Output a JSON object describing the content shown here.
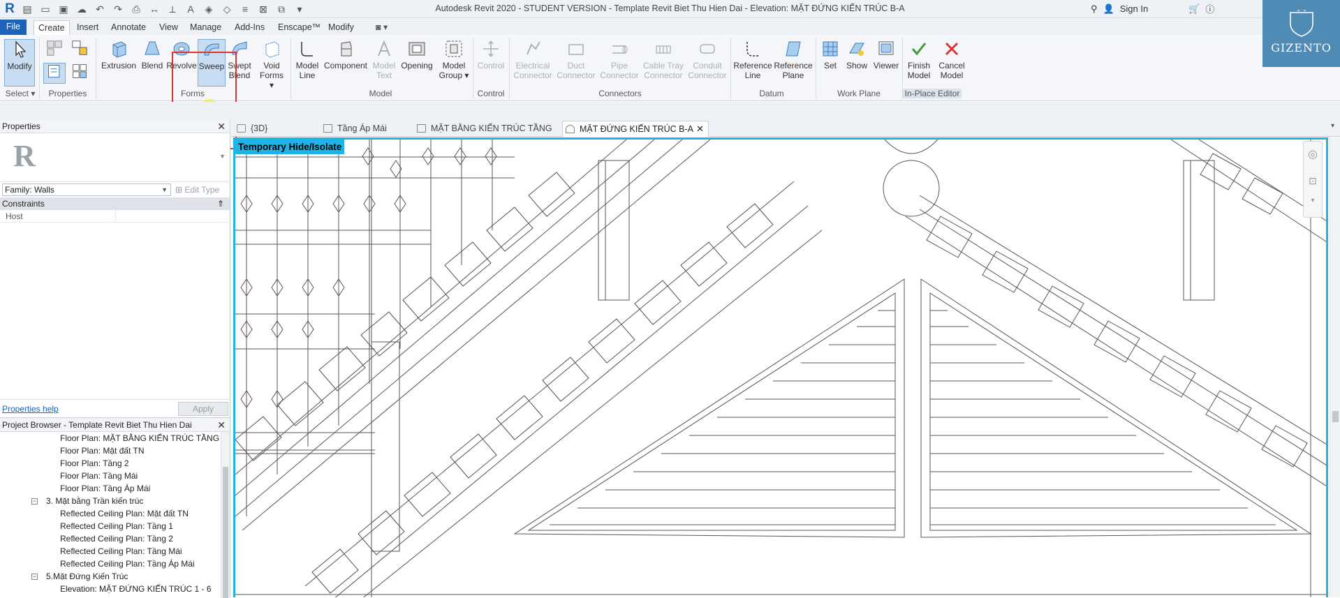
{
  "titlebar": {
    "title": "Autodesk Revit 2020 - STUDENT VERSION - Template Revit Biet Thu Hien Dai - Elevation: MẶT ĐỨNG KIẾN TRÚC B-A",
    "sign_in": "Sign In"
  },
  "menu": [
    "File",
    "Create",
    "Insert",
    "Annotate",
    "View",
    "Manage",
    "Add-Ins",
    "Enscape™",
    "Modify"
  ],
  "ribbon": {
    "select": {
      "modify": "Modify",
      "label": "Select"
    },
    "properties_label": "Properties",
    "forms": {
      "extrusion": "Extrusion",
      "blend": "Blend",
      "revolve": "Revolve",
      "sweep": "Sweep",
      "swept_blend_1": "Swept",
      "swept_blend_2": "Blend",
      "void_1": "Void",
      "void_2": "Forms",
      "label": "Forms"
    },
    "model": {
      "model_line_1": "Model",
      "model_line_2": "Line",
      "component": "Component",
      "model_text_1": "Model",
      "model_text_2": "Text",
      "opening": "Opening",
      "model_group_1": "Model",
      "model_group_2": "Group",
      "label": "Model"
    },
    "control": {
      "control": "Control",
      "label": "Control"
    },
    "connectors": {
      "electrical_1": "Electrical",
      "electrical_2": "Connector",
      "duct_1": "Duct",
      "duct_2": "Connector",
      "pipe_1": "Pipe",
      "pipe_2": "Connector",
      "cable_1": "Cable Tray",
      "cable_2": "Connector",
      "conduit_1": "Conduit",
      "conduit_2": "Connector",
      "label": "Connectors"
    },
    "datum": {
      "ref_line_1": "Reference",
      "ref_line_2": "Line",
      "ref_plane_1": "Reference",
      "ref_plane_2": "Plane",
      "label": "Datum"
    },
    "work_plane": {
      "set": "Set",
      "show": "Show",
      "viewer": "Viewer",
      "label": "Work Plane"
    },
    "inplace": {
      "finish_1": "Finish",
      "finish_2": "Model",
      "cancel_1": "Cancel",
      "cancel_2": "Model",
      "label": "In-Place Editor"
    }
  },
  "brand": {
    "name": "GIZENTO",
    "initial": "G"
  },
  "properties": {
    "title": "Properties",
    "family": "Family: Walls",
    "edit_type": "Edit Type",
    "constraints": "Constraints",
    "host": "Host",
    "help": "Properties help",
    "apply": "Apply"
  },
  "project_browser": {
    "title": "Project Browser - Template Revit Biet Thu Hien Dai",
    "items": [
      {
        "label": "Floor Plan: MẶT BẰNG KIẾN TRÚC TẦNG 1",
        "level": 2
      },
      {
        "label": "Floor Plan: Mặt đất TN",
        "level": 2
      },
      {
        "label": "Floor Plan: Tầng 2",
        "level": 2
      },
      {
        "label": "Floor Plan: Tầng Mái",
        "level": 2
      },
      {
        "label": "Floor Plan: Tầng Áp Mái",
        "level": 2
      },
      {
        "label": "3. Mặt bằng Trần kiến trúc",
        "level": 1
      },
      {
        "label": "Reflected Ceiling Plan: Mặt đất TN",
        "level": 2
      },
      {
        "label": "Reflected Ceiling Plan: Tầng 1",
        "level": 2
      },
      {
        "label": "Reflected Ceiling Plan: Tầng 2",
        "level": 2
      },
      {
        "label": "Reflected Ceiling Plan: Tầng Mái",
        "level": 2
      },
      {
        "label": "Reflected Ceiling Plan: Tầng Áp Mái",
        "level": 2
      },
      {
        "label": "5.Mặt Đứng Kiến Trúc",
        "level": 1
      },
      {
        "label": "Elevation: MẶT ĐỨNG KIẾN TRÚC 1 - 6",
        "level": 2
      }
    ]
  },
  "view_tabs": [
    {
      "label": "{3D}",
      "active": false
    },
    {
      "label": "Tầng Áp Mái",
      "active": false
    },
    {
      "label": "MẶT BẰNG KIẾN TRÚC TẦNG 1",
      "active": false
    },
    {
      "label": "MẶT ĐỨNG KIẾN TRÚC B-A",
      "active": true
    }
  ],
  "canvas": {
    "banner": "Temporary Hide/Isolate",
    "banner_color": "#1fb3e6"
  },
  "colors": {
    "accent": "#1b62b8",
    "highlight": "#e0332b",
    "brand_bg": "#4f8bb4"
  }
}
